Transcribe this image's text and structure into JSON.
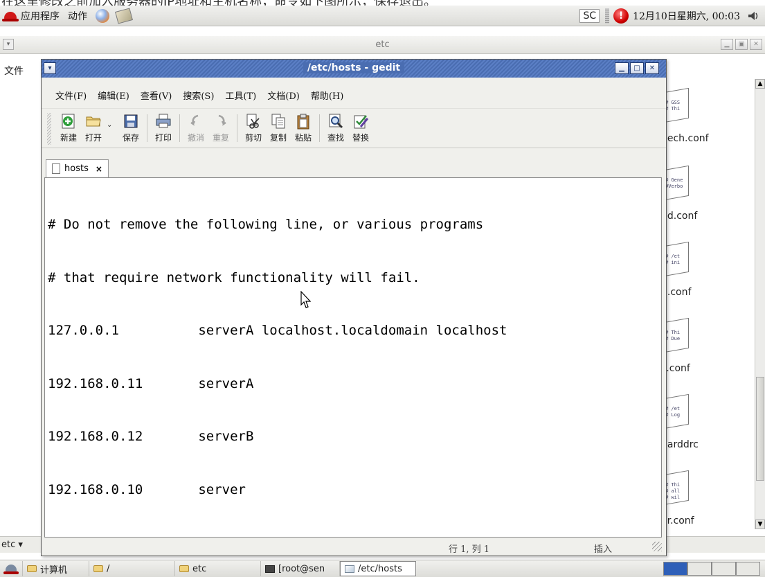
{
  "caption": "在这里修改之前加入服务器的IP地址和主机名称，命令如下图所示，保存退出。",
  "top_panel": {
    "applications": "应用程序",
    "actions": "动作",
    "input_method": "SC",
    "clock": "12月10日星期六, 00:03"
  },
  "background_window": {
    "title": "etc",
    "menu_partial": "文件",
    "location": "etc",
    "files": [
      {
        "preview": [
          "# GSS",
          "# Thi"
        ],
        "label": "nech.conf"
      },
      {
        "preview": [
          "# Gene",
          "#Verbo"
        ],
        "label": "pd.conf"
      },
      {
        "preview": [
          "# /et",
          "# ini"
        ],
        "label": "g.conf"
      },
      {
        "preview": [
          "# Thi",
          "# Due"
        ],
        "label": "s.conf"
      },
      {
        "preview": [
          "# /et",
          "# Log"
        ],
        "label": "uarddrc"
      },
      {
        "preview": [
          "# Thi",
          "# all",
          "# wil"
        ],
        "label": "er.conf"
      }
    ]
  },
  "gedit": {
    "title": "/etc/hosts - gedit",
    "menu": [
      "文件(F)",
      "编辑(E)",
      "查看(V)",
      "搜索(S)",
      "工具(T)",
      "文档(D)",
      "帮助(H)"
    ],
    "toolbar": {
      "new": "新建",
      "open": "打开",
      "save": "保存",
      "print": "打印",
      "undo": "撤消",
      "redo": "重复",
      "cut": "剪切",
      "copy": "复制",
      "paste": "粘贴",
      "find": "查找",
      "replace": "替换"
    },
    "tab": {
      "label": "hosts",
      "close": "×"
    },
    "lines": [
      "# Do not remove the following line, or various programs",
      "# that require network functionality will fail.",
      "127.0.0.1          serverA localhost.localdomain localhost",
      "192.168.0.11       serverA",
      "192.168.0.12       serverB",
      "192.168.0.10       server"
    ],
    "status": {
      "position": "行 1, 列 1",
      "mode": "插入"
    }
  },
  "taskbar": {
    "tasks": [
      "计算机",
      "/",
      "etc",
      "[root@sen",
      "/etc/hosts"
    ]
  },
  "colors": {
    "title_active": "#4a6db1",
    "workspace_active": "#2e5fb8"
  }
}
